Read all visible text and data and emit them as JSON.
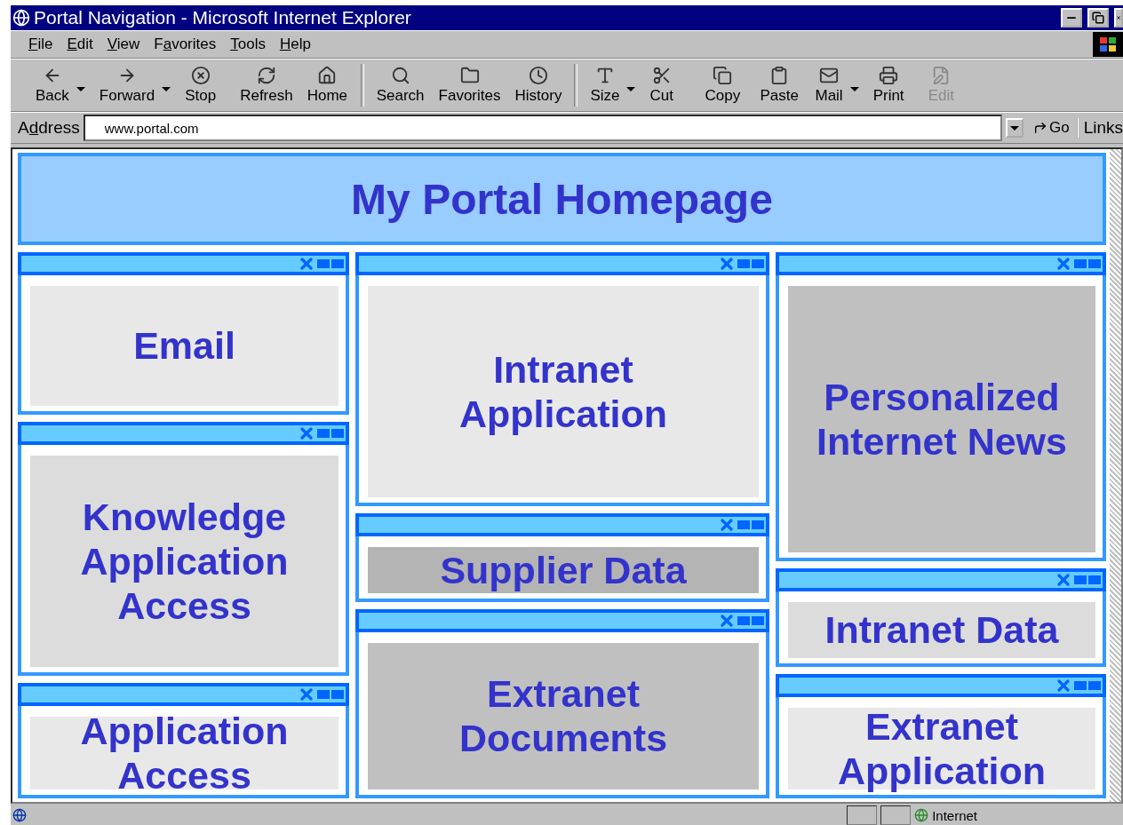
{
  "window": {
    "title": "Portal Navigation - Microsoft Internet Explorer"
  },
  "menu": [
    {
      "label": "File"
    },
    {
      "label": "Edit"
    },
    {
      "label": "View"
    },
    {
      "label": "Favorites"
    },
    {
      "label": "Tools"
    },
    {
      "label": "Help"
    }
  ],
  "toolbar": [
    {
      "kind": "back",
      "label": "Back",
      "dropdown": true,
      "disabled": false
    },
    {
      "kind": "forward",
      "label": "Forward",
      "dropdown": true,
      "disabled": false
    },
    {
      "kind": "stop",
      "label": "Stop",
      "dropdown": false,
      "disabled": false
    },
    {
      "kind": "refresh",
      "label": "Refresh",
      "dropdown": false,
      "disabled": false
    },
    {
      "kind": "home",
      "label": "Home",
      "dropdown": false,
      "disabled": false
    },
    {
      "kind": "separator"
    },
    {
      "kind": "search",
      "label": "Search",
      "dropdown": false,
      "disabled": false
    },
    {
      "kind": "favorites",
      "label": "Favorites",
      "dropdown": false,
      "disabled": false
    },
    {
      "kind": "history",
      "label": "History",
      "dropdown": false,
      "disabled": false
    },
    {
      "kind": "separator"
    },
    {
      "kind": "size",
      "label": "Size",
      "dropdown": true,
      "disabled": false
    },
    {
      "kind": "cut",
      "label": "Cut",
      "dropdown": false,
      "disabled": false
    },
    {
      "kind": "copy",
      "label": "Copy",
      "dropdown": false,
      "disabled": false
    },
    {
      "kind": "paste",
      "label": "Paste",
      "dropdown": false,
      "disabled": false
    },
    {
      "kind": "mail",
      "label": "Mail",
      "dropdown": true,
      "disabled": false
    },
    {
      "kind": "print",
      "label": "Print",
      "dropdown": false,
      "disabled": false
    },
    {
      "kind": "edit",
      "label": "Edit",
      "dropdown": false,
      "disabled": true
    }
  ],
  "address": {
    "label": "Address",
    "value": "www.portal.com",
    "go": "Go",
    "links": "Links"
  },
  "portal": {
    "title": "My Portal Homepage",
    "columns": [
      [
        {
          "title": "Email",
          "color": "#e8e8e8"
        },
        {
          "title": "Knowledge Application Access",
          "color": "#dcdcdc"
        },
        {
          "title": "Application Access",
          "color": "#e8e8e8"
        }
      ],
      [
        {
          "title": "Intranet Application",
          "color": "#e8e8e8"
        },
        {
          "title": "Supplier Data",
          "color": "#b4b4b4"
        },
        {
          "title": "Extranet Documents",
          "color": "#c0c0c0"
        }
      ],
      [
        {
          "title": "Personalized Internet News",
          "color": "#c0c0c0"
        },
        {
          "title": "Intranet Data",
          "color": "#dcdcdc"
        },
        {
          "title": "Extranet Application",
          "color": "#e8e8e8"
        }
      ]
    ]
  },
  "status_bar": {
    "zone": "Internet"
  }
}
